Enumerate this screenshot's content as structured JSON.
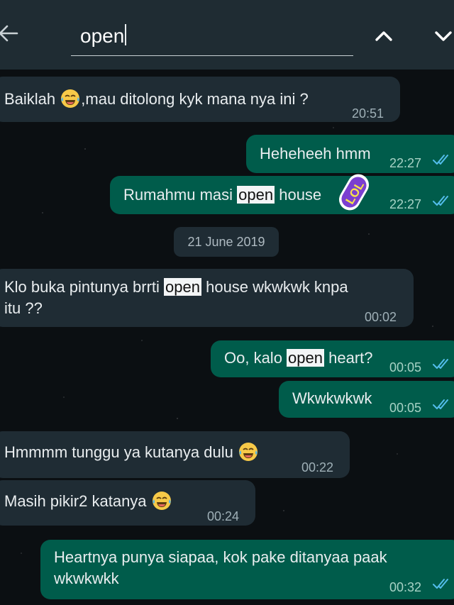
{
  "search": {
    "query": "open"
  },
  "date_chip": "21 June 2019",
  "messages": [
    {
      "dir": "in",
      "pre": "Baiklah ",
      "post": ",mau ditolong kyk mana nya ini ?",
      "time": "20:51"
    },
    {
      "dir": "out",
      "text": "Heheheeh hmm",
      "time": "22:27"
    },
    {
      "dir": "out",
      "pre": "Rumahmu masi ",
      "hl": "open",
      "post": " house",
      "tail": "?",
      "time": "22:27"
    },
    {
      "dir": "in",
      "pre": "Klo buka pintunya brrti ",
      "hl": "open",
      "post": " house wkwkwk knpa",
      "line2": "itu ??",
      "time": "00:02"
    },
    {
      "dir": "out",
      "pre": "Oo, kalo ",
      "hl": "open",
      "post": " heart?",
      "time": "00:05"
    },
    {
      "dir": "out",
      "text": "Wkwkwkwk",
      "time": "00:05"
    },
    {
      "dir": "in",
      "text": "Hmmmm tunggu ya kutanya dulu ",
      "time": "00:22"
    },
    {
      "dir": "in",
      "text": "Masih pikir2 katanya ",
      "time": "00:24"
    },
    {
      "dir": "out",
      "text": "Heartnya punya siapaa, kok pake ditanyaa paak",
      "line2": "wkwkwkk",
      "time": "00:32"
    }
  ],
  "sticker": {
    "label": "LOL"
  },
  "icons": {
    "back": "arrow-left-icon",
    "up": "chevron-up-icon",
    "down": "chevron-down-icon",
    "emoji": "laughing-tears-emoji-icon",
    "ticks": "double-check-icon"
  },
  "colors": {
    "header": "#1f2c33",
    "incoming": "#1f2c34",
    "outgoing": "#005c4b",
    "ticks": "#53bdeb"
  }
}
